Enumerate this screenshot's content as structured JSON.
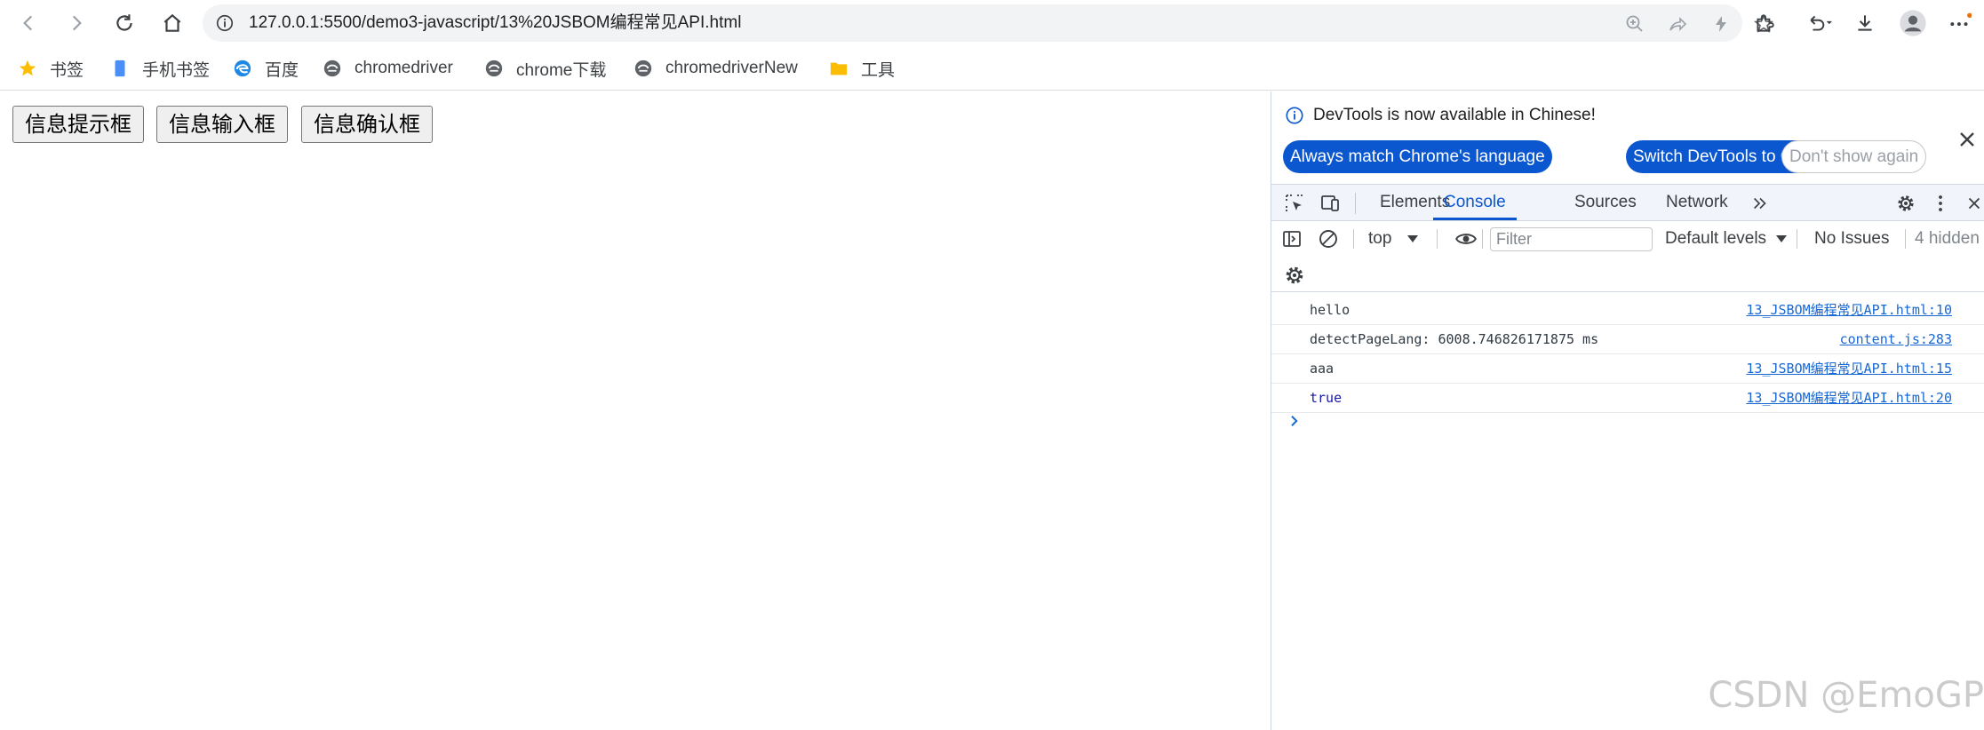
{
  "browser": {
    "url": "127.0.0.1:5500/demo3-javascript/13%20JSBOM编程常见API.html"
  },
  "bookmarks": [
    {
      "label": "书签",
      "icon": "star-icon"
    },
    {
      "label": "手机书签",
      "icon": "phone-icon"
    },
    {
      "label": "百度",
      "icon": "edge-icon"
    },
    {
      "label": "chromedriver",
      "icon": "globe-icon"
    },
    {
      "label": "chrome下载",
      "icon": "globe-icon"
    },
    {
      "label": "chromedriverNew",
      "icon": "globe-icon"
    },
    {
      "label": "工具",
      "icon": "folder-icon"
    }
  ],
  "page": {
    "buttons": [
      "信息提示框",
      "信息输入框",
      "信息确认框"
    ]
  },
  "devtools": {
    "infobar": {
      "message": "DevTools is now available in Chinese!",
      "match_label": "Always match Chrome's language",
      "switch_label": "Switch DevTools to Chinese",
      "dismiss_label": "Don't show again"
    },
    "tabs": [
      "Elements",
      "Console",
      "Sources",
      "Network"
    ],
    "active_tab": "Console",
    "console": {
      "context": "top",
      "filter_placeholder": "Filter",
      "levels": "Default levels",
      "issues": "No Issues",
      "hidden": "4 hidden"
    },
    "logs": [
      {
        "message": "hello",
        "source": "13_JSBOM编程常见API.html:10"
      },
      {
        "message": "detectPageLang: 6008.746826171875 ms",
        "source": "content.js:283"
      },
      {
        "message": "aaa",
        "source": "13_JSBOM编程常见API.html:15"
      },
      {
        "message": "true",
        "source": "13_JSBOM编程常见API.html:20"
      }
    ]
  },
  "watermark": "CSDN @EmoGP",
  "colors": {
    "accent": "#0b57d0",
    "link": "#1967d2"
  }
}
